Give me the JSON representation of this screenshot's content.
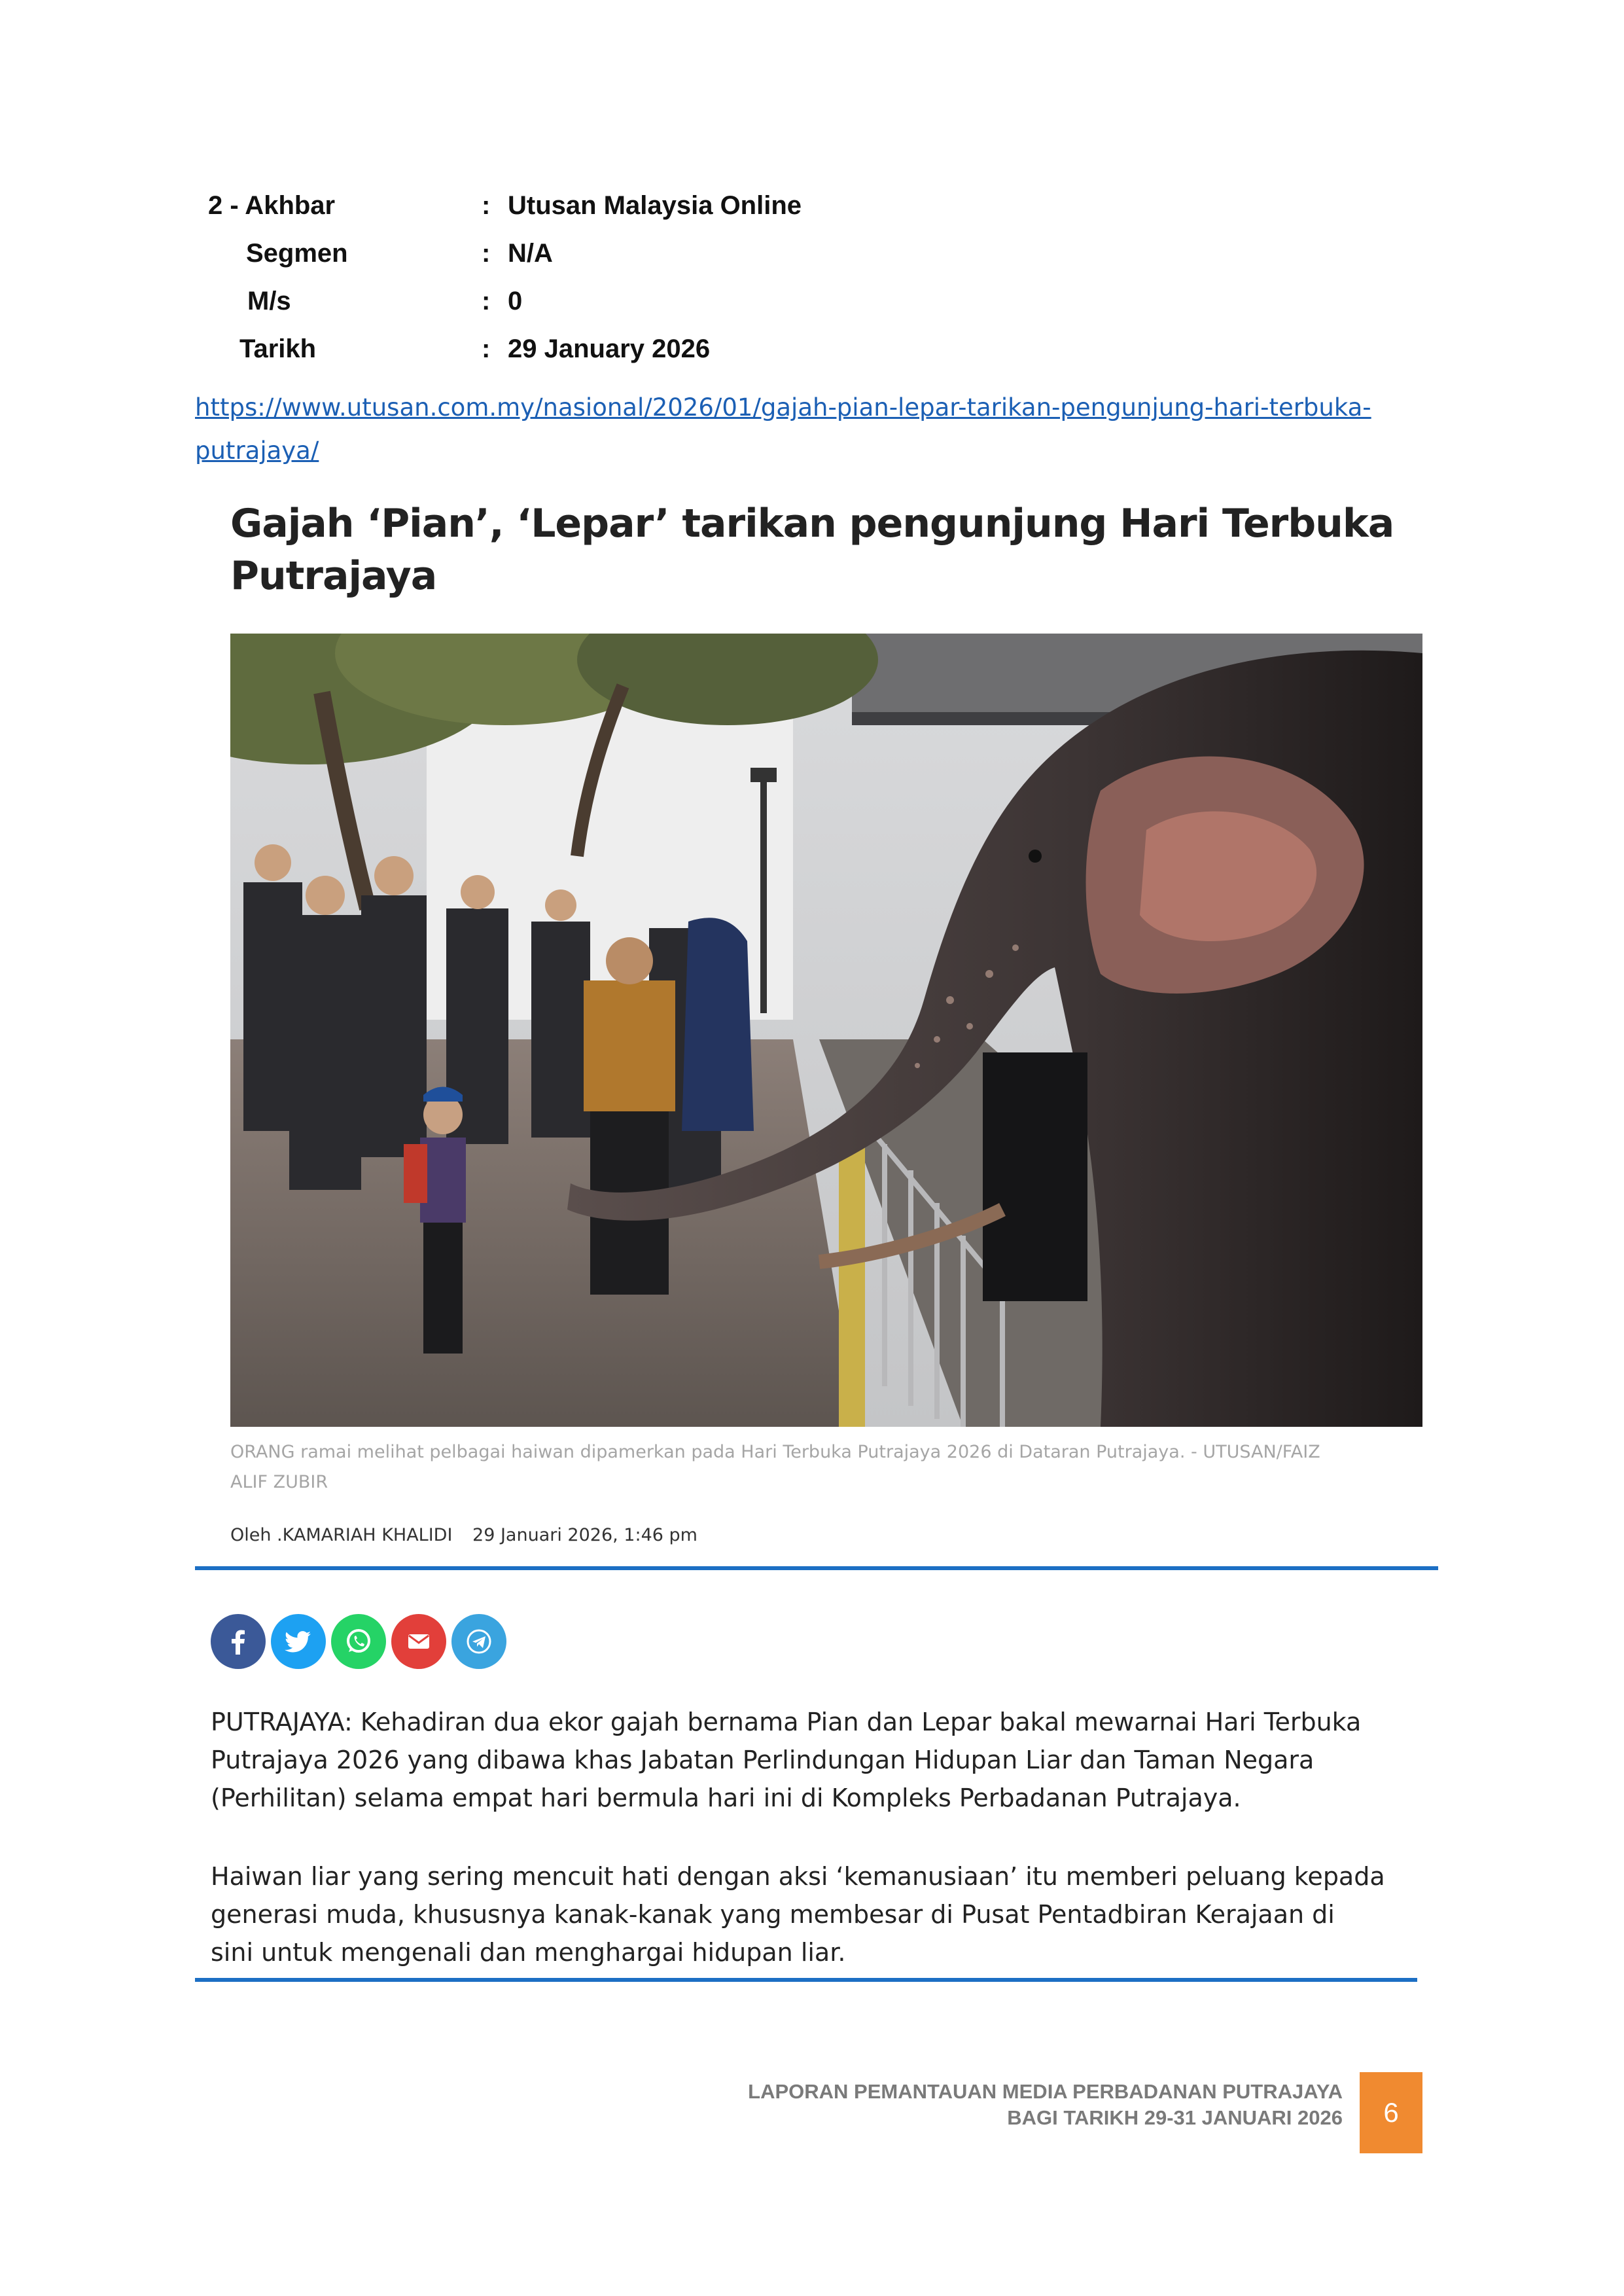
{
  "meta": {
    "akhbar_label": "2 - Akhbar",
    "akhbar_value": "Utusan Malaysia Online",
    "segmen_label": "Segmen",
    "segmen_value": "N/A",
    "ms_label": "M/s",
    "ms_value": "0",
    "tarikh_label": "Tarikh",
    "tarikh_value": "29 January 2026",
    "colon": ":"
  },
  "link": {
    "line1": "https://www.utusan.com.my/nasional/2026/01/gajah-pian-lepar-tarikan-pengunjung-hari-terbuka-",
    "line2": "putrajaya/"
  },
  "article": {
    "headline_line1": "Gajah ‘Pian’, ‘Lepar’ tarikan pengunjung Hari Terbuka",
    "headline_line2": "Putrajaya",
    "caption_line1": "ORANG ramai melihat pelbagai haiwan dipamerkan pada Hari Terbuka Putrajaya 2026 di Dataran Putrajaya. - UTUSAN/FAIZ",
    "caption_line2": "ALIF ZUBIR",
    "author": "Oleh .KAMARIAH KHALIDI",
    "date": "29 Januari 2026, 1:46 pm",
    "share_icons": [
      "facebook-icon",
      "twitter-icon",
      "whatsapp-icon",
      "email-icon",
      "telegram-icon"
    ],
    "share_colors": [
      "#3b5998",
      "#1da1f2",
      "#25d366",
      "#e23f3a",
      "#3aa4df"
    ],
    "para1": [
      "PUTRAJAYA: Kehadiran dua ekor gajah bernama Pian dan Lepar bakal mewarnai Hari Terbuka",
      "Putrajaya 2026 yang dibawa khas Jabatan Perlindungan Hidupan Liar dan Taman Negara",
      "(Perhilitan) selama empat hari bermula hari ini di Kompleks Perbadanan Putrajaya."
    ],
    "para2": [
      "Haiwan liar yang sering mencuit hati dengan aksi ‘kemanusiaan’ itu memberi peluang kepada",
      "generasi muda, khususnya kanak-kanak yang membesar di Pusat Pentadbiran Kerajaan di",
      "sini untuk mengenali dan menghargai hidupan liar."
    ]
  },
  "footer": {
    "line1": "LAPORAN PEMANTAUAN MEDIA PERBADANAN PUTRAJAYA",
    "line2": "BAGI TARIKH 29-31 JANUARI 2026",
    "page_number": "6"
  },
  "colors": {
    "link": "#1b5fb4",
    "rule": "#1c6fc4",
    "page_box": "#f08a30"
  }
}
